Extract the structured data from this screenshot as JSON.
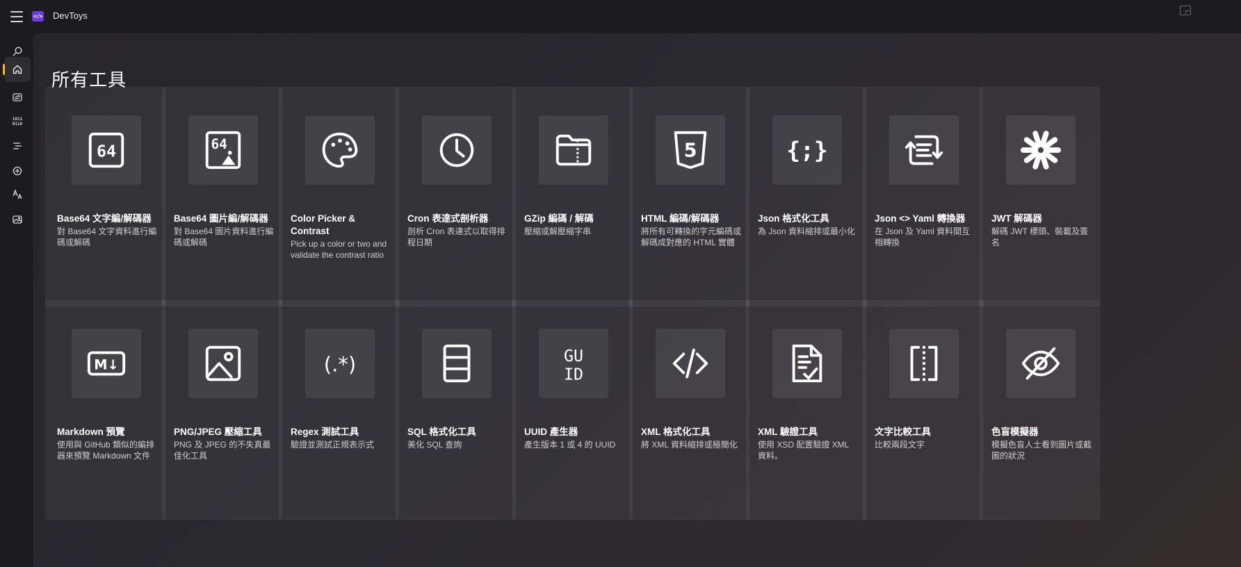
{
  "app": {
    "title": "DevToys",
    "logo_text": "</>"
  },
  "page": {
    "title": "所有工具"
  },
  "sidebar": {
    "items": [
      {
        "name": "search-icon"
      },
      {
        "name": "home-icon",
        "active": true
      },
      {
        "name": "converters-icon"
      },
      {
        "name": "encoders-icon",
        "text": "1011\n0110"
      },
      {
        "name": "formatters-icon"
      },
      {
        "name": "generators-icon"
      },
      {
        "name": "text-icon"
      },
      {
        "name": "graphic-icon"
      }
    ]
  },
  "tools": [
    {
      "title": "Base64 文字編/解碼器",
      "desc": "對 Base64 文字資料進行編碼或解碼",
      "icon": "base64-text-icon",
      "icon_text": "64"
    },
    {
      "title": "Base64 圖片編/解碼器",
      "desc": "對 Base64 圖片資料進行編碼或解碼",
      "icon": "base64-image-icon",
      "icon_text": "64"
    },
    {
      "title": "Color Picker & Contrast",
      "desc": "Pick up a color or two and validate the contrast ratio",
      "icon": "palette-icon"
    },
    {
      "title": "Cron 表達式剖析器",
      "desc": "剖析 Cron 表達式以取得排程日期",
      "icon": "clock-icon"
    },
    {
      "title": "GZip 編碼 / 解碼",
      "desc": "壓縮或解壓縮字串",
      "icon": "zip-folder-icon"
    },
    {
      "title": "HTML 編碼/解碼器",
      "desc": "將所有可轉換的字元編碼或解碼成對應的 HTML 實體",
      "icon": "html5-icon",
      "icon_text": "5"
    },
    {
      "title": "Json 格式化工具",
      "desc": "為 Json 資料縮排或最小化",
      "icon": "json-braces-icon",
      "icon_text": "{;}"
    },
    {
      "title": "Json <> Yaml 轉換器",
      "desc": "在 Json 及 Yaml 資料間互相轉換",
      "icon": "json-yaml-convert-icon"
    },
    {
      "title": "JWT 解碼器",
      "desc": "解碼 JWT 標頭、裝載及簽名",
      "icon": "jwt-icon"
    },
    {
      "title": "Markdown 預覽",
      "desc": "使用與 GitHub 類似的編排器來預覽 Markdown 文件",
      "icon": "markdown-icon",
      "icon_text": "M↓"
    },
    {
      "title": "PNG/JPEG 壓縮工具",
      "desc": "PNG 及 JPEG 的不失真最佳化工具",
      "icon": "image-icon"
    },
    {
      "title": "Regex 測試工具",
      "desc": "驗證並測試正規表示式",
      "icon": "regex-icon",
      "icon_text": "(.*)"
    },
    {
      "title": "SQL 格式化工具",
      "desc": "美化 SQL 查詢",
      "icon": "database-table-icon"
    },
    {
      "title": "UUID 產生器",
      "desc": "產生版本 1 或 4 的 UUID",
      "icon": "guid-icon",
      "icon_text": "GUID"
    },
    {
      "title": "XML 格式化工具",
      "desc": "將 XML 資料縮排或極簡化",
      "icon": "xml-code-icon",
      "icon_text": "</>"
    },
    {
      "title": "XML 驗證工具",
      "desc": "使用 XSD 配置驗證 XML 資料。",
      "icon": "document-check-icon"
    },
    {
      "title": "文字比較工具",
      "desc": "比較兩段文字",
      "icon": "text-diff-icon"
    },
    {
      "title": "色盲模擬器",
      "desc": "模擬色盲人士看到圖片或截圖的狀況",
      "icon": "eye-off-icon"
    }
  ]
}
